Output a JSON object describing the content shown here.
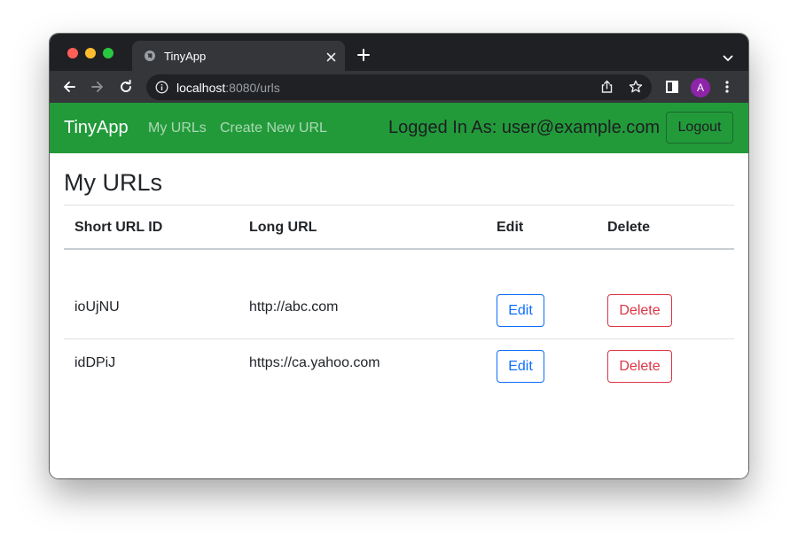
{
  "browser": {
    "tab_title": "TinyApp",
    "url_host": "localhost",
    "url_path": ":8080/urls",
    "avatar_letter": "A"
  },
  "navbar": {
    "brand": "TinyApp",
    "links": [
      "My URLs",
      "Create New URL"
    ],
    "logged_in_text": "Logged In As: user@example.com",
    "logout_label": "Logout",
    "bg_color": "#229a3a"
  },
  "page": {
    "title": "My URLs"
  },
  "table": {
    "headers": [
      "Short URL ID",
      "Long URL",
      "Edit",
      "Delete"
    ],
    "rows": [
      {
        "short_id": "ioUjNU",
        "long_url": "http://abc.com",
        "edit_label": "Edit",
        "delete_label": "Delete"
      },
      {
        "short_id": "idDPiJ",
        "long_url": "https://ca.yahoo.com",
        "edit_label": "Edit",
        "delete_label": "Delete"
      }
    ]
  },
  "colors": {
    "edit": "#0d6efd",
    "delete": "#dc3545"
  },
  "icons": {
    "tab": "globe-icon",
    "close": "close-icon",
    "new_tab": "plus-icon",
    "back": "back-arrow-icon",
    "forward": "forward-arrow-icon",
    "reload": "reload-icon",
    "info": "info-icon",
    "share": "share-icon",
    "star": "star-icon",
    "side_panel": "side-panel-icon",
    "menu": "kebab-menu-icon"
  }
}
